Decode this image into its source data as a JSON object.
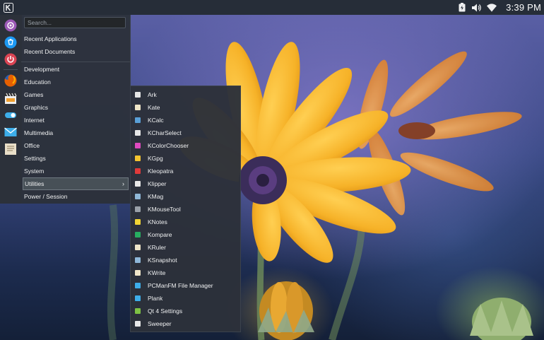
{
  "colors": {
    "panel_bg": "#262d38",
    "menu_bg": "#2c313a",
    "selection_bg": "#475057",
    "text": "#eff0f1",
    "petal": "#f6b228",
    "flower_center": "#3b2d5a"
  },
  "top_panel": {
    "launcher_icon": "kde-icon",
    "tray_icons": [
      "battery-icon",
      "volume-icon",
      "wifi-icon"
    ],
    "clock": "3:39 PM"
  },
  "favorites": [
    {
      "name": "system-settings-icon",
      "color": "#9b59b6"
    },
    {
      "name": "software-center-icon",
      "color": "#1d99f3"
    },
    {
      "name": "power-icon",
      "color": "#da4453"
    },
    {
      "name": "firefox-icon",
      "color": "#e66000"
    },
    {
      "name": "clapper-icon",
      "color": "#eeeeee"
    },
    {
      "name": "toggle-icon",
      "color": "#3daee9"
    },
    {
      "name": "mail-icon",
      "color": "#3daee9"
    },
    {
      "name": "text-editor-icon",
      "color": "#eadfc8"
    }
  ],
  "menu": {
    "search_placeholder": "Search...",
    "recent": [
      "Recent Applications",
      "Recent Documents"
    ],
    "categories": [
      "Development",
      "Education",
      "Games",
      "Graphics",
      "Internet",
      "Multimedia",
      "Office",
      "Settings",
      "System",
      "Utilities",
      "Power / Session"
    ],
    "selected_category": "Utilities",
    "selected_chevron": "›"
  },
  "submenu": {
    "items": [
      {
        "label": "Ark",
        "icon": "ark-icon",
        "color": "#e6e6e6"
      },
      {
        "label": "Kate",
        "icon": "kate-icon",
        "color": "#f0e6c8"
      },
      {
        "label": "KCalc",
        "icon": "kcalc-icon",
        "color": "#5aa0d8"
      },
      {
        "label": "KCharSelect",
        "icon": "kcharselect-icon",
        "color": "#e8e8e8"
      },
      {
        "label": "KColorChooser",
        "icon": "kcolorchooser-icon",
        "color": "#e04ac0"
      },
      {
        "label": "KGpg",
        "icon": "kgpg-icon",
        "color": "#f4c430"
      },
      {
        "label": "Kleopatra",
        "icon": "kleopatra-icon",
        "color": "#e03a3a"
      },
      {
        "label": "Klipper",
        "icon": "klipper-icon",
        "color": "#e8e8e8"
      },
      {
        "label": "KMag",
        "icon": "kmag-icon",
        "color": "#8fb8d8"
      },
      {
        "label": "KMouseTool",
        "icon": "kmousetool-icon",
        "color": "#9aa1a9"
      },
      {
        "label": "KNotes",
        "icon": "knotes-icon",
        "color": "#f2d534"
      },
      {
        "label": "Kompare",
        "icon": "kompare-icon",
        "color": "#27ae60"
      },
      {
        "label": "KRuler",
        "icon": "kruler-icon",
        "color": "#f0e6c8"
      },
      {
        "label": "KSnapshot",
        "icon": "ksnapshot-icon",
        "color": "#8fb8d8"
      },
      {
        "label": "KWrite",
        "icon": "kwrite-icon",
        "color": "#f0e6c8"
      },
      {
        "label": "PCManFM File Manager",
        "icon": "file-manager-icon",
        "color": "#3daee9"
      },
      {
        "label": "Plank",
        "icon": "plank-icon",
        "color": "#3daee9"
      },
      {
        "label": "Qt 4 Settings",
        "icon": "qt-settings-icon",
        "color": "#7ec244"
      },
      {
        "label": "Sweeper",
        "icon": "sweeper-icon",
        "color": "#e8e8e8"
      }
    ]
  }
}
